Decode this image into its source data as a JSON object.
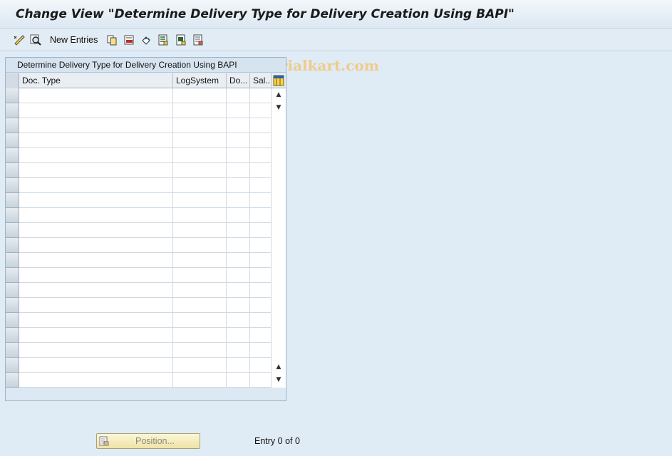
{
  "window": {
    "title": "Change View \"Determine Delivery Type for Delivery Creation Using BAPI\""
  },
  "toolbar": {
    "new_entries_label": "New Entries",
    "watermark": "www.tutorialkart.com",
    "icons": [
      "display-change-icon",
      "details-icon",
      "copy-as-icon",
      "delete-icon",
      "undo-icon",
      "select-all-icon",
      "select-block-icon",
      "deselect-all-icon"
    ]
  },
  "table": {
    "caption": "Determine Delivery Type for Delivery Creation Using BAPI",
    "columns": [
      "Doc. Type",
      "LogSystem",
      "Do...",
      "Sal..."
    ],
    "row_count": 20
  },
  "footer": {
    "position_label": "Position...",
    "entry_info": "Entry 0 of 0"
  },
  "colors": {
    "background": "#dfebf5",
    "watermark": "#f2c87e",
    "position_button": "#f4ebbd"
  }
}
